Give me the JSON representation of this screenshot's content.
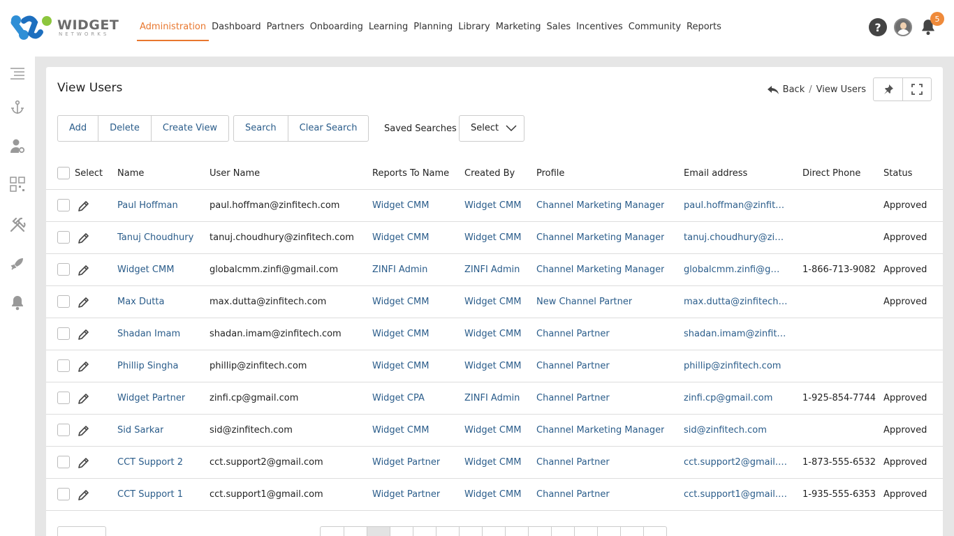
{
  "logo": {
    "word": "WIDGET",
    "sub": "NETWORKS"
  },
  "nav": [
    {
      "label": "Administration",
      "active": true
    },
    {
      "label": "Dashboard"
    },
    {
      "label": "Partners"
    },
    {
      "label": "Onboarding"
    },
    {
      "label": "Learning"
    },
    {
      "label": "Planning"
    },
    {
      "label": "Library"
    },
    {
      "label": "Marketing"
    },
    {
      "label": "Sales"
    },
    {
      "label": "Incentives"
    },
    {
      "label": "Community"
    },
    {
      "label": "Reports"
    }
  ],
  "header": {
    "help_icon": "?",
    "notification_count": "5"
  },
  "sidebar_icons": [
    "menu-icon",
    "anchor-icon",
    "user-settings-icon",
    "qr-code-icon",
    "tools-icon",
    "rocket-icon",
    "bell-icon"
  ],
  "page": {
    "title": "View Users",
    "back_label": "Back",
    "crumb_sep": "/",
    "crumb_current": "View Users"
  },
  "actions": {
    "add": "Add",
    "delete": "Delete",
    "create_view": "Create View",
    "search": "Search",
    "clear_search": "Clear Search",
    "saved_searches_label": "Saved Searches",
    "saved_searches_value": "Select"
  },
  "table": {
    "headers": {
      "select": "Select",
      "name": "Name",
      "user_name": "User Name",
      "reports_to": "Reports To Name",
      "created_by": "Created By",
      "profile": "Profile",
      "email": "Email address",
      "phone": "Direct Phone",
      "status": "Status"
    },
    "rows": [
      {
        "name": "Paul Hoffman",
        "user_name": "paul.hoffman@zinfitech.com",
        "reports_to": "Widget CMM",
        "created_by": "Widget CMM",
        "profile": "Channel Marketing Manager",
        "email": "paul.hoffman@zinfit…",
        "phone": "",
        "status": "Approved"
      },
      {
        "name": "Tanuj Choudhury",
        "user_name": "tanuj.choudhury@zinfitech.com",
        "reports_to": "Widget CMM",
        "created_by": "Widget CMM",
        "profile": "Channel Marketing Manager",
        "email": "tanuj.choudhury@zi…",
        "phone": "",
        "status": "Approved"
      },
      {
        "name": "Widget CMM",
        "user_name": "globalcmm.zinfi@gmail.com",
        "reports_to": "ZINFI Admin",
        "created_by": "ZINFI Admin",
        "profile": "Channel Marketing Manager",
        "email": "globalcmm.zinfi@g…",
        "phone": "1-866-713-9082",
        "status": "Approved"
      },
      {
        "name": "Max Dutta",
        "user_name": "max.dutta@zinfitech.com",
        "reports_to": "Widget CMM",
        "created_by": "Widget CMM",
        "profile": "New Channel Partner",
        "email": "max.dutta@zinfitech…",
        "phone": "",
        "status": "Approved"
      },
      {
        "name": "Shadan Imam",
        "user_name": "shadan.imam@zinfitech.com",
        "reports_to": "Widget CMM",
        "created_by": "Widget CMM",
        "profile": "Channel Partner",
        "email": "shadan.imam@zinfit…",
        "phone": "",
        "status": ""
      },
      {
        "name": "Phillip Singha",
        "user_name": "phillip@zinfitech.com",
        "reports_to": "Widget CMM",
        "created_by": "Widget CMM",
        "profile": "Channel Partner",
        "email": "phillip@zinfitech.com",
        "phone": "",
        "status": ""
      },
      {
        "name": "Widget Partner",
        "user_name": "zinfi.cp@gmail.com",
        "reports_to": "Widget CPA",
        "created_by": "ZINFI Admin",
        "profile": "Channel Partner",
        "email": "zinfi.cp@gmail.com",
        "phone": "1-925-854-7744",
        "status": "Approved"
      },
      {
        "name": "Sid Sarkar",
        "user_name": "sid@zinfitech.com",
        "reports_to": "Widget CMM",
        "created_by": "Widget CMM",
        "profile": "Channel Marketing Manager",
        "email": "sid@zinfitech.com",
        "phone": "",
        "status": "Approved"
      },
      {
        "name": "CCT Support 2",
        "user_name": "cct.support2@gmail.com",
        "reports_to": "Widget Partner",
        "created_by": "Widget CMM",
        "profile": "Channel Partner",
        "email": "cct.support2@gmail.…",
        "phone": "1-873-555-6532",
        "status": "Approved"
      },
      {
        "name": "CCT Support 1",
        "user_name": "cct.support1@gmail.com",
        "reports_to": "Widget Partner",
        "created_by": "Widget CMM",
        "profile": "Channel Partner",
        "email": "cct.support1@gmail.…",
        "phone": "1-935-555-6353",
        "status": "Approved"
      }
    ]
  },
  "colors": {
    "accent": "#e8772e",
    "link": "#2a5c8a",
    "badge": "#ef8a3a"
  }
}
